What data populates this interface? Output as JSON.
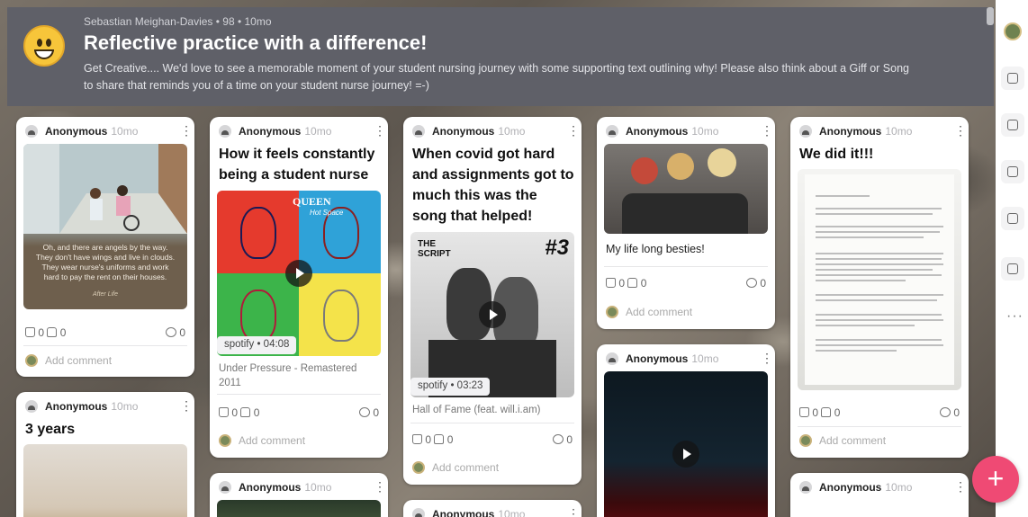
{
  "header": {
    "meta": "Sebastian Meighan-Davies • 98 • 10mo",
    "title": "Reflective practice with a difference!",
    "description": "Get Creative.... We'd love to see a memorable moment of your student nursing journey with some supporting text outlining why! Please also think about a Giff or Song to share that reminds you of a time on your student nurse journey! =-)"
  },
  "common": {
    "author": "Anonymous",
    "time": "10mo",
    "likes": "0",
    "dislikes": "0",
    "comments": "0",
    "add_comment": "Add comment",
    "kebab": "⋮",
    "fab": "+"
  },
  "cards": {
    "c1": {
      "image_text": "Oh, and there are angels by the way. They don't have wings and live in clouds. They wear nurse's uniforms and work hard to pay the rent on their houses.",
      "image_sig": "After Life"
    },
    "c2": {
      "subject": "How it feels constantly being a student nurse",
      "source": "spotify",
      "duration": "04:08",
      "caption": "Under Pressure - Remastered 2011"
    },
    "c3": {
      "subject": "When covid got hard and assignments got to much this was the song that helped!",
      "source": "spotify",
      "duration": "03:23",
      "caption": "Hall of Fame (feat. will.i.am)"
    },
    "c4": {
      "body": "My life long besties!"
    },
    "c5": {
      "subject": "We did it!!!"
    },
    "c6": {
      "subject": "3 years"
    }
  },
  "album_art": {
    "queen": "QUEEN",
    "queen_sub": "Hot Space",
    "script": "THE SCRIPT",
    "script_num": "#3"
  },
  "sidebar": {
    "more": "···"
  },
  "colors": {
    "header_bg": "#5f6068",
    "fab": "#ef4a74",
    "accent_yellow": "#f7c53a"
  }
}
